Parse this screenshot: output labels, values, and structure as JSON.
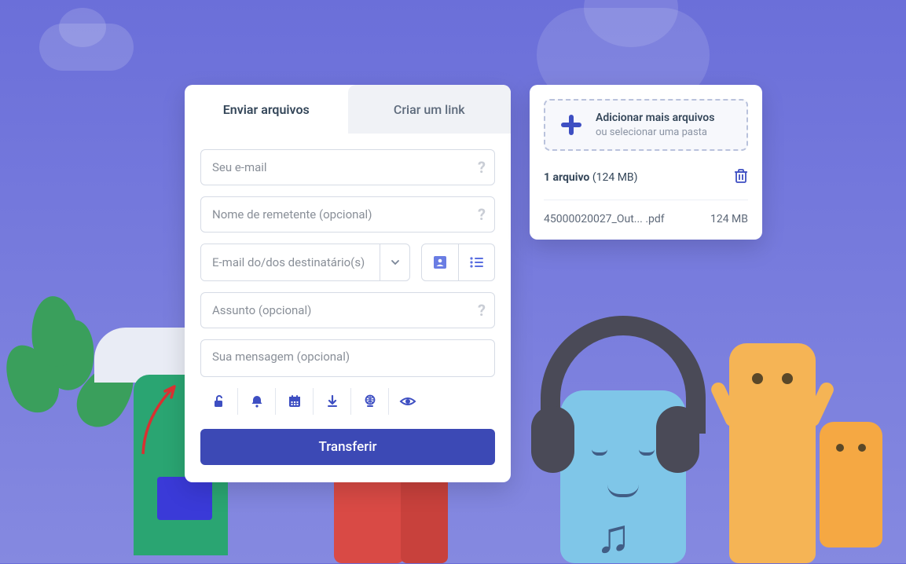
{
  "tabs": {
    "send": "Enviar arquivos",
    "link": "Criar um link"
  },
  "form": {
    "email_placeholder": "Seu e-mail",
    "sender_name_placeholder": "Nome de remetente (opcional)",
    "recipients_placeholder": "E-mail do/dos destinatário(s)",
    "subject_placeholder": "Assunto (opcional)",
    "message_placeholder": "Sua mensagem (opcional)",
    "transfer_button": "Transferir"
  },
  "files": {
    "add_more_heading": "Adicionar mais arquivos",
    "add_more_sub": "ou selecionar uma pasta",
    "count_label": "1 arquivo",
    "count_size": "(124 MB)",
    "rows": [
      {
        "name": "45000020027_Out... .pdf",
        "size": "124 MB"
      }
    ]
  },
  "colors": {
    "primary": "#3c49b5",
    "accent": "#3e4fc2"
  }
}
